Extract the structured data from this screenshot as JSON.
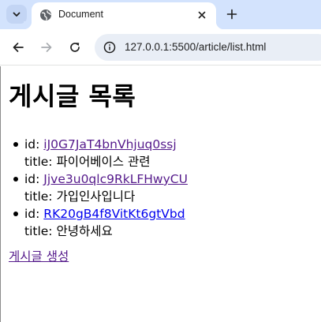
{
  "browser": {
    "tab": {
      "title": "Document"
    },
    "url": "127.0.0.1:5500/article/list.html"
  },
  "page": {
    "heading": "게시글 목록",
    "articles": [
      {
        "id_label": "id: ",
        "id": "iJ0G7JaT4bnVhjuq0ssj",
        "title_label": "title: ",
        "title": "파이어베이스 관련",
        "visited": true
      },
      {
        "id_label": "id: ",
        "id": "Jjve3u0qlc9RkLFHwyCU",
        "title_label": "title: ",
        "title": "가입인사입니다",
        "visited": true
      },
      {
        "id_label": "id: ",
        "id": "RK20gB4f8VitKt6gtVbd",
        "title_label": "title: ",
        "title": "안녕하세요",
        "visited": false
      }
    ],
    "create_link": "게시글 생성"
  },
  "colors": {
    "tabstrip": "#d3e3fd",
    "omnibox": "#e9eef6",
    "visited_link": "#551a8b",
    "unvisited_link": "#0000ee"
  }
}
